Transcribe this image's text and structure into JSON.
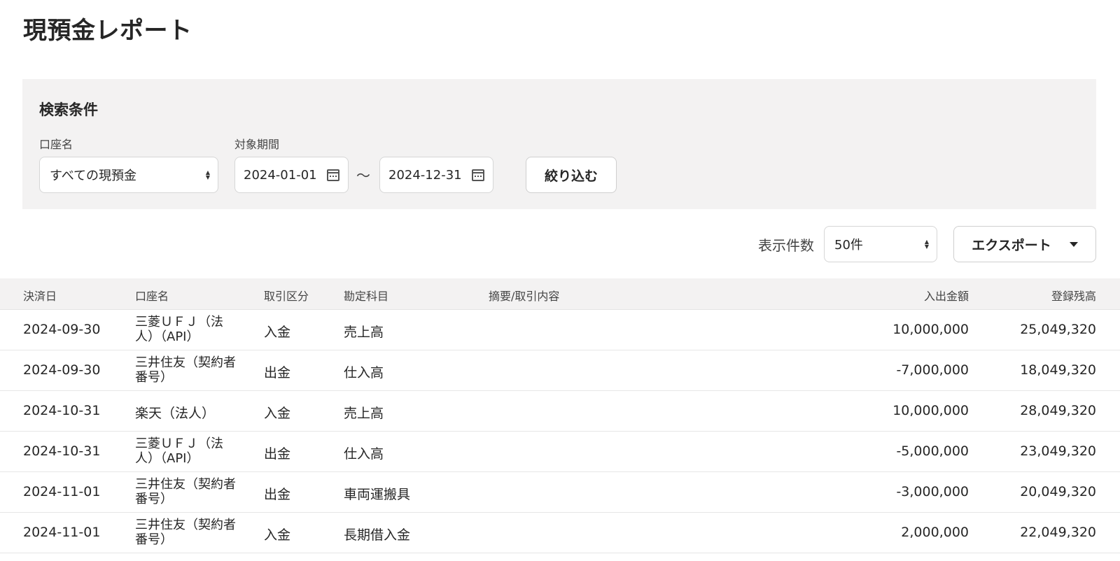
{
  "page": {
    "title": "現預金レポート"
  },
  "search": {
    "title": "検索条件",
    "account_label": "口座名",
    "account_value": "すべての現預金",
    "period_label": "対象期間",
    "date_from": "2024-01-01",
    "date_to": "2024-12-31",
    "range_separator": "～",
    "filter_button": "絞り込む"
  },
  "toolbar": {
    "per_page_label": "表示件数",
    "per_page_value": "50件",
    "export_button": "エクスポート"
  },
  "table": {
    "headers": {
      "date": "決済日",
      "account": "口座名",
      "type": "取引区分",
      "subject": "勘定科目",
      "memo": "摘要/取引内容",
      "amount": "入出金額",
      "balance": "登録残高"
    },
    "rows": [
      {
        "date": "2024-09-30",
        "account": "三菱ＵＦＪ（法人）（API）",
        "type": "入金",
        "subject": "売上高",
        "memo": "",
        "amount": "10,000,000",
        "balance": "25,049,320"
      },
      {
        "date": "2024-09-30",
        "account": "三井住友（契約者番号）",
        "type": "出金",
        "subject": "仕入高",
        "memo": "",
        "amount": "-7,000,000",
        "balance": "18,049,320"
      },
      {
        "date": "2024-10-31",
        "account": "楽天（法人）",
        "type": "入金",
        "subject": "売上高",
        "memo": "",
        "amount": "10,000,000",
        "balance": "28,049,320"
      },
      {
        "date": "2024-10-31",
        "account": "三菱ＵＦＪ（法人）（API）",
        "type": "出金",
        "subject": "仕入高",
        "memo": "",
        "amount": "-5,000,000",
        "balance": "23,049,320"
      },
      {
        "date": "2024-11-01",
        "account": "三井住友（契約者番号）",
        "type": "出金",
        "subject": "車両運搬具",
        "memo": "",
        "amount": "-3,000,000",
        "balance": "20,049,320"
      },
      {
        "date": "2024-11-01",
        "account": "三井住友（契約者番号）",
        "type": "入金",
        "subject": "長期借入金",
        "memo": "",
        "amount": "2,000,000",
        "balance": "22,049,320"
      }
    ]
  },
  "icons": {
    "calendar": "calendar-icon",
    "select_arrows": "select-arrows-icon",
    "dropdown_caret": "chevron-down-icon"
  }
}
